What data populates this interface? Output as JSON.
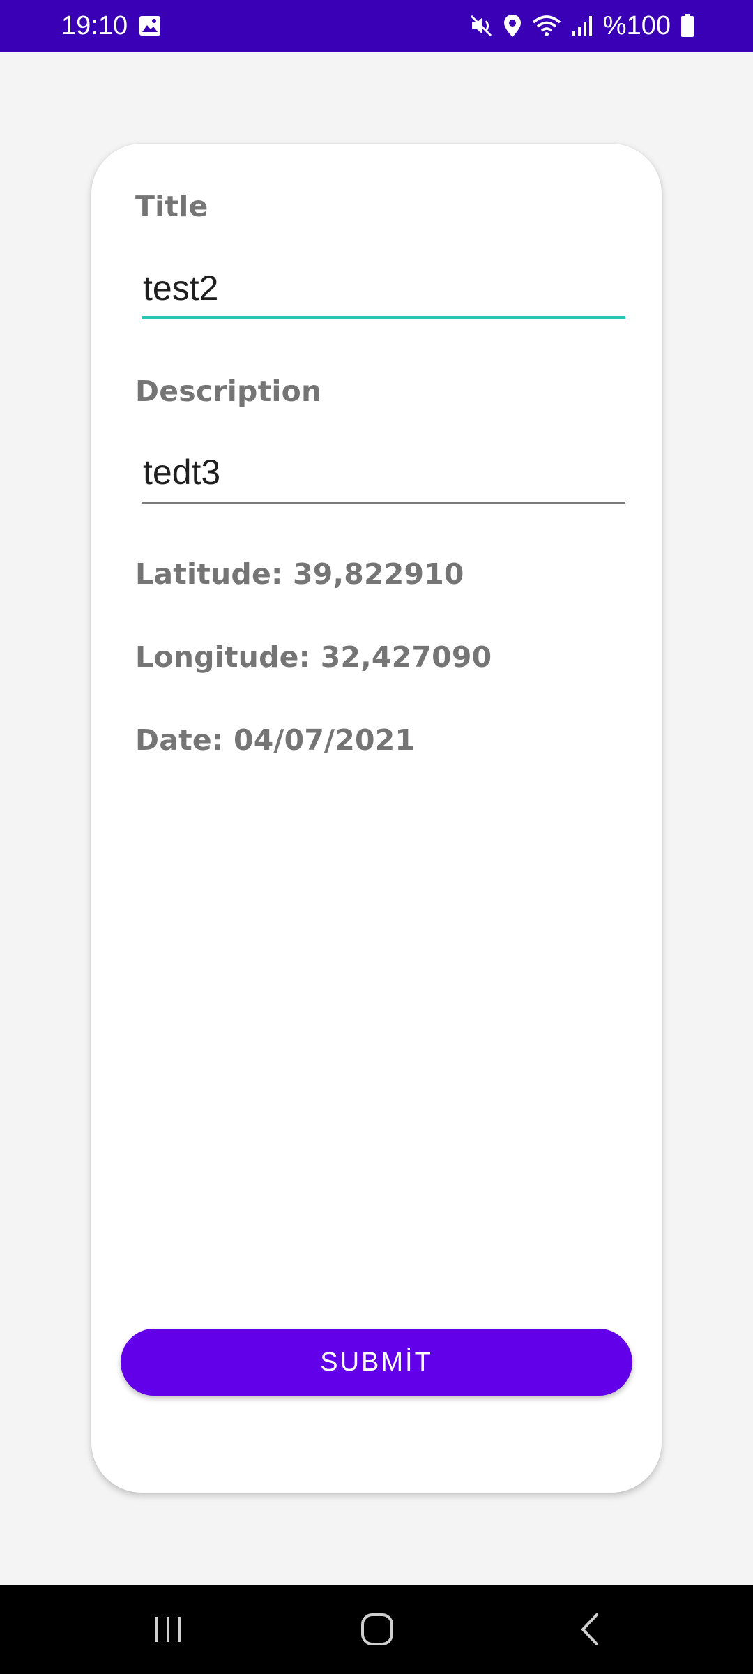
{
  "status_bar": {
    "time": "19:10",
    "battery": "%100",
    "icons": [
      "gallery-icon",
      "mute-icon",
      "location-icon",
      "wifi-icon",
      "signal-icon",
      "battery-icon"
    ],
    "color": "#3a00b5"
  },
  "form": {
    "title_label": "Title",
    "title_value": "test2",
    "description_label": "Description",
    "description_value": "tedt3",
    "latitude": "Latitude: 39,822910",
    "longitude": "Longitude: 32,427090",
    "date": "Date: 04/07/2021",
    "submit_label": "SUBMİT",
    "accent_color": "#6200ea",
    "focus_color": "#26c6b3"
  },
  "nav_bar": {
    "icons": [
      "recent-apps-icon",
      "home-icon",
      "back-icon"
    ]
  }
}
